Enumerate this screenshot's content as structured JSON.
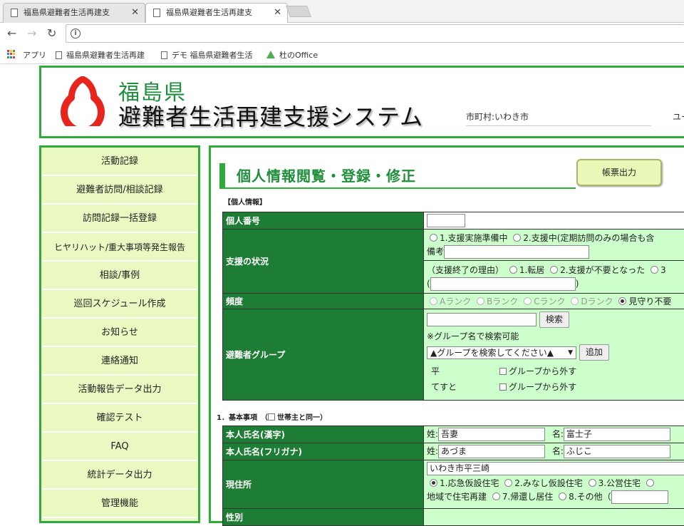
{
  "browser": {
    "tabs": [
      {
        "title": "福島県避難者生活再建支",
        "close": "✕"
      },
      {
        "title": "福島県避難者生活再建支",
        "close": "✕"
      }
    ],
    "bookmarks": [
      {
        "label": "アプリ"
      },
      {
        "label": "福島県避難者生活再建"
      },
      {
        "label": "デモ 福島県避難者生活"
      },
      {
        "label": "杜のOffice"
      }
    ]
  },
  "header": {
    "brand_line1": "福島県",
    "brand_line2": "避難者生活再建支援システム",
    "city": "市町村:いわき市",
    "user": "ユー"
  },
  "sidebar": {
    "items": [
      {
        "label": "活動記録"
      },
      {
        "label": "避難者訪問/相談記録"
      },
      {
        "label": "訪問記録一括登録"
      },
      {
        "label": "ヒヤリハット/重大事項等発生報告"
      },
      {
        "label": "相談/事例"
      },
      {
        "label": "巡回スケジュール作成"
      },
      {
        "label": "お知らせ"
      },
      {
        "label": "連絡通知"
      },
      {
        "label": "活動報告データ出力"
      },
      {
        "label": "確認テスト"
      },
      {
        "label": "FAQ"
      },
      {
        "label": "統計データ出力"
      },
      {
        "label": "管理機能"
      }
    ]
  },
  "main": {
    "title": "個人情報閲覧・登録・修正",
    "print_button": "帳票出力",
    "section_personal": "【個人情報】",
    "section_basic": "1．基本事項　（",
    "section_basic_check": "世帯主と同一）",
    "rows": {
      "kojin_bango": {
        "label": "個人番号"
      },
      "shien": {
        "label": "支援の状況",
        "option1": "1.支援実施準備中",
        "option2": "2.支援中(定期訪問のみの場合も含",
        "biko": "備考",
        "end_reason": "（支援終了の理由）",
        "end1": "1.転居",
        "end2": "2.支援が不要となった",
        "end3": "3",
        "paren_open": "(",
        "paren_close": ")"
      },
      "hindo": {
        "label": "頻度",
        "rankA": "Aランク",
        "rankB": "Bランク",
        "rankC": "Cランク",
        "rankD": "Dランク",
        "mimamori": "見守り不要"
      },
      "group": {
        "label": "避難者グループ",
        "search_button": "検索",
        "note": "※グループ名で検索可能",
        "select_value": "▲グループを検索してください▲",
        "add_button": "追加",
        "members": [
          {
            "name": "平",
            "remove": "グループから外す"
          },
          {
            "name": "てすと",
            "remove": "グループから外す"
          }
        ]
      },
      "name_kanji": {
        "label": "本人氏名(漢字)",
        "sei_label": "姓:",
        "sei": "吾妻",
        "mei_label": "名:",
        "mei": "富士子"
      },
      "name_kana": {
        "label": "本人氏名(フリガナ)",
        "sei_label": "姓:",
        "sei": "あづま",
        "mei_label": "名:",
        "mei": "ふじこ"
      },
      "address": {
        "label": "現住所",
        "value": "いわき市平三崎",
        "opt1": "1.応急仮設住宅",
        "opt2": "2.みなし仮設住宅",
        "opt3": "3.公営住宅",
        "opt6": "地域で住宅再建",
        "opt7": "7.帰還し居住",
        "opt8": "8.その他（"
      },
      "next": {
        "label": "性別"
      }
    }
  }
}
